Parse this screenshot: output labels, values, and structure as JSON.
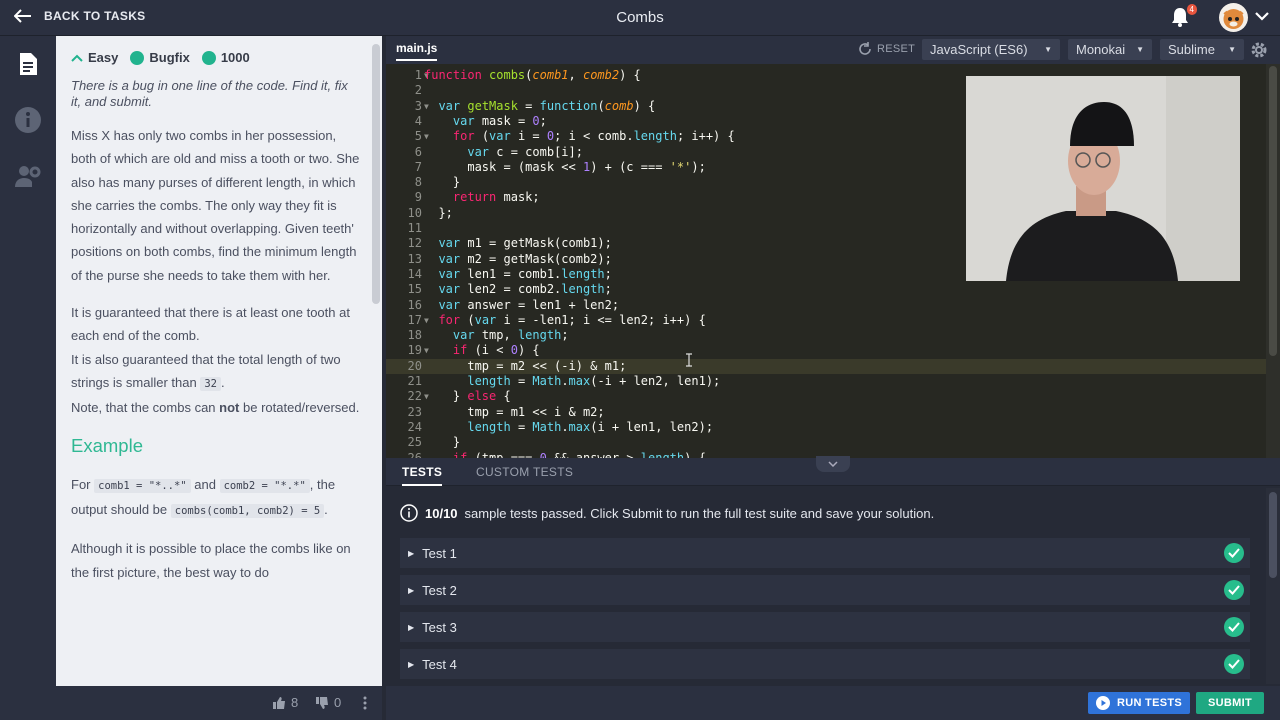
{
  "header": {
    "back_label": "BACK TO TASKS",
    "title": "Combs",
    "notification_count": "4"
  },
  "sidebar": {
    "items": [
      "description-icon",
      "info-icon",
      "settings-icon"
    ]
  },
  "description": {
    "difficulty": "Easy",
    "type": "Bugfix",
    "points": "1000",
    "intro": "There is a bug in one line of the code. Find it, fix it, and submit.",
    "p1": "Miss X has only two combs in her possession, both of which are old and miss a tooth or two. She also has many purses of different length, in which she carries the combs. The only way they fit is horizontally and without overlapping. Given teeth' positions on both combs, find the minimum length of the purse she needs to take them with her.",
    "p2a": "It is guaranteed that there is at least one tooth at each end of the comb.",
    "p2b": "It is also guaranteed that the total length of two strings is smaller than",
    "p2b_code": "32",
    "p2b_end": ".",
    "p2c_pre": "Note, that the combs can",
    "p2c_bold": "not",
    "p2c_post": "be rotated/reversed.",
    "example_heading": "Example",
    "ex_for": "For",
    "ex_code1": "comb1 = \"*..*\"",
    "ex_and": "and",
    "ex_code2": "comb2 = \"*.*\"",
    "ex_mid": ", the output should be",
    "ex_code3": "combs(comb1, comb2) = 5",
    "ex_end": ".",
    "p4": "Although it is possible to place the combs like on the first picture, the best way to do"
  },
  "description_footer": {
    "likes": "8",
    "dislikes": "0"
  },
  "editor": {
    "file_tab": "main.js",
    "reset_label": "RESET",
    "language": "JavaScript (ES6)",
    "theme": "Monokai",
    "keymap": "Sublime"
  },
  "code_lines": [
    "1",
    "2",
    "3",
    "4",
    "5",
    "6",
    "7",
    "8",
    "9",
    "10",
    "11",
    "12",
    "13",
    "14",
    "15",
    "16",
    "17",
    "18",
    "19",
    "20",
    "21",
    "22",
    "23",
    "24",
    "25",
    "26"
  ],
  "panel": {
    "tab_tests": "TESTS",
    "tab_custom": "CUSTOM TESTS",
    "status_bold": "10/10",
    "status_text": "sample tests passed. Click Submit to run the full test suite and save your solution.",
    "tests": [
      "Test 1",
      "Test 2",
      "Test 3",
      "Test 4"
    ]
  },
  "footer": {
    "run_label": "RUN TESTS",
    "submit_label": "SUBMIT"
  },
  "colors": {
    "accent": "#21b38e",
    "run": "#2f73d9",
    "submit": "#1fa882"
  }
}
